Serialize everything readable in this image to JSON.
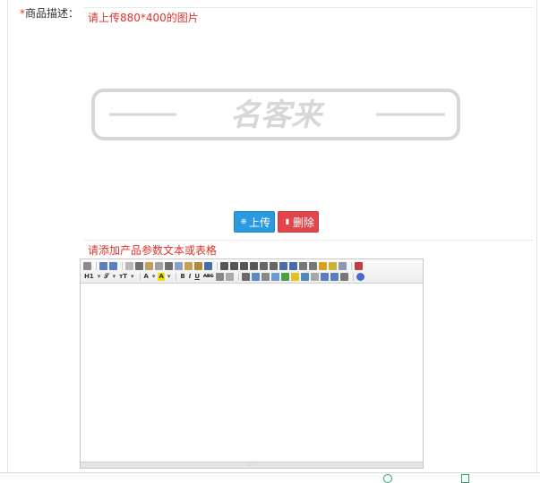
{
  "product_desc": {
    "label_required": "*",
    "label": "商品描述：",
    "upload_hint": "请上传880*400的图片",
    "logo_text": "名客来"
  },
  "actions": {
    "upload_label": "上传",
    "delete_label": "删除"
  },
  "params": {
    "hint": "请添加产品参数文本或表格"
  },
  "editor": {
    "toolbar_row1": [
      "source-icon",
      "undo-icon",
      "redo-icon",
      "preview-icon",
      "print-icon",
      "template-icon",
      "paste-text-icon",
      "cut-icon",
      "copy-icon",
      "paste-icon",
      "paste-plain-icon",
      "paste-word-icon",
      "justify-left-icon",
      "justify-center-icon",
      "justify-right-icon",
      "justify-full-icon",
      "ordered-list-icon",
      "unordered-list-icon",
      "indent-icon",
      "outdent-icon",
      "subscript-icon",
      "superscript-icon",
      "clear-format-icon",
      "select-all-icon",
      "find-icon",
      "fullscreen-icon"
    ],
    "toolbar_row2_text": {
      "heading": "H1",
      "font": "𝒯",
      "size": "тT",
      "forecolor": "A",
      "hilite": "A",
      "bold": "B",
      "italic": "I",
      "underline": "U",
      "strike": "ABC"
    },
    "colors": {
      "accent_upload": "#2a9be1",
      "accent_delete": "#e0474d",
      "hint": "#e0322b"
    }
  }
}
